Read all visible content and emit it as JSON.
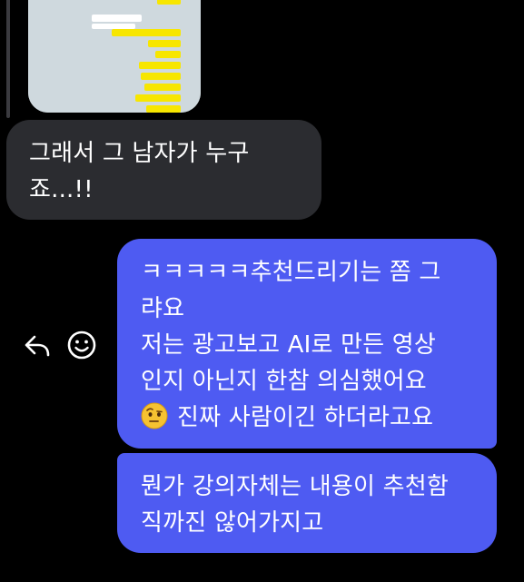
{
  "messages": {
    "incoming": {
      "line1": "그래서 그 남자가 누구",
      "line2": "죠...!!"
    },
    "outgoing_first": {
      "line1": "ㅋㅋㅋㅋㅋ추천드리기는 쫌 그",
      "line2": "랴요",
      "line3": "저는 광고보고 AI로 만든 영상",
      "line4": "인지 아닌지 한참 의심했어요",
      "line5": "진짜 사람이긴 하더라고요",
      "emoji": "face-with-raised-eyebrow-icon"
    },
    "outgoing_second": {
      "line1": "뭔가 강의자체는 내용이 추천함",
      "line2": "직까진 않어가지고"
    }
  },
  "actions": {
    "reply": "reply-icon",
    "react": "smiley-icon"
  },
  "colors": {
    "background": "#000000",
    "incoming_bubble": "#2b2c30",
    "outgoing_bubble": "#4e5bf2",
    "text": "#ffffff"
  }
}
